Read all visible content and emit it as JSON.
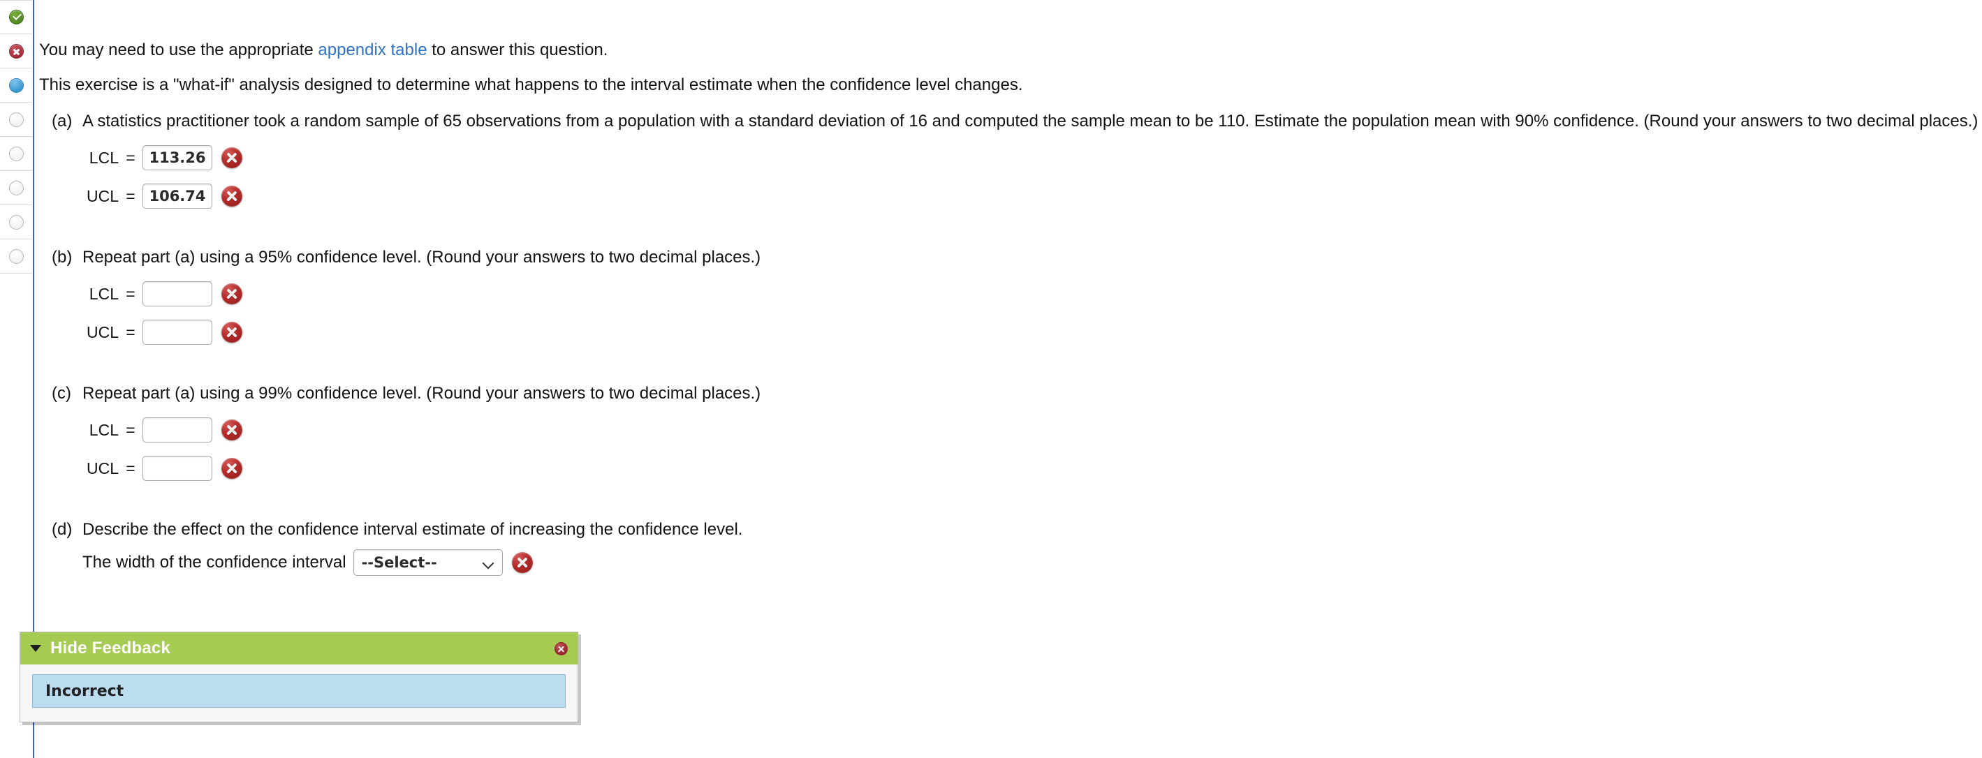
{
  "status_rail": {
    "items": [
      {
        "state": "correct",
        "name": "question-status-correct"
      },
      {
        "state": "incorrect",
        "name": "question-status-incorrect"
      },
      {
        "state": "current",
        "name": "question-status-current"
      },
      {
        "state": "empty",
        "name": "question-status-unanswered-1"
      },
      {
        "state": "empty",
        "name": "question-status-unanswered-2"
      },
      {
        "state": "empty",
        "name": "question-status-unanswered-3"
      },
      {
        "state": "empty",
        "name": "question-status-unanswered-4"
      },
      {
        "state": "empty",
        "name": "question-status-unanswered-5"
      }
    ]
  },
  "intro": {
    "line1_before": "You may need to use the appropriate ",
    "line1_link": "appendix table",
    "line1_after": " to answer this question.",
    "line2": "This exercise is a \"what-if\" analysis designed to determine what happens to the interval estimate when the confidence level changes."
  },
  "parts": {
    "a": {
      "label": "(a)",
      "text": "A statistics practitioner took a random sample of 65 observations from a population with a standard deviation of 16 and computed the sample mean to be 110. Estimate the population mean with 90% confidence. (Round your answers to two decimal places.)",
      "rows": [
        {
          "label": "LCL",
          "eq": "=",
          "value": "113.26",
          "status": "incorrect"
        },
        {
          "label": "UCL",
          "eq": "=",
          "value": "106.74",
          "status": "incorrect"
        }
      ]
    },
    "b": {
      "label": "(b)",
      "text": "Repeat part (a) using a 95% confidence level. (Round your answers to two decimal places.)",
      "rows": [
        {
          "label": "LCL",
          "eq": "=",
          "value": "",
          "status": "incorrect"
        },
        {
          "label": "UCL",
          "eq": "=",
          "value": "",
          "status": "incorrect"
        }
      ]
    },
    "c": {
      "label": "(c)",
      "text": "Repeat part (a) using a 99% confidence level. (Round your answers to two decimal places.)",
      "rows": [
        {
          "label": "LCL",
          "eq": "=",
          "value": "",
          "status": "incorrect"
        },
        {
          "label": "UCL",
          "eq": "=",
          "value": "",
          "status": "incorrect"
        }
      ]
    },
    "d": {
      "label": "(d)",
      "text": "Describe the effect on the confidence interval estimate of increasing the confidence level.",
      "select_prefix": "The width of the confidence interval",
      "select_value": "--Select--",
      "select_status": "incorrect"
    }
  },
  "feedback": {
    "title": "Hide Feedback",
    "caret_icon": "triangle-down-icon",
    "close_icon": "close-icon",
    "status": "Incorrect"
  },
  "colors": {
    "header_green": "#A5CB53",
    "status_blue": "#BCDCEF",
    "link_blue": "#2F72C4",
    "rule_blue": "#3A63C8",
    "error_red": "#B32A28",
    "correct_green": "#4F8A1E",
    "current_blue": "#3D9BD4"
  }
}
